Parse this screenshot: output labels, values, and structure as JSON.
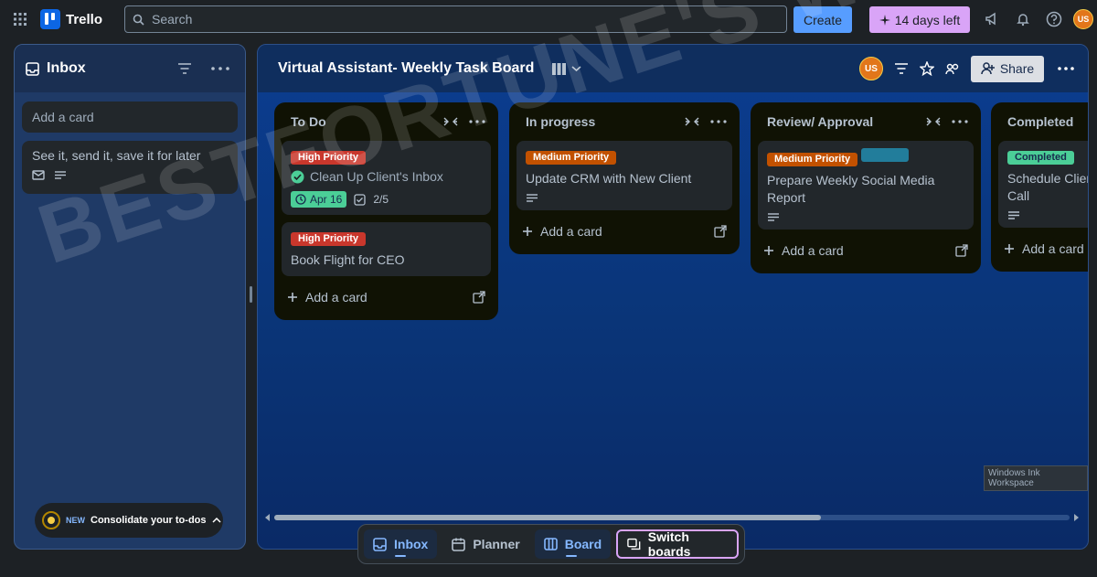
{
  "topbar": {
    "app_name": "Trello",
    "search_placeholder": "Search",
    "create_label": "Create",
    "trial_label": "14 days left",
    "avatar_initials": "US"
  },
  "inbox": {
    "title": "Inbox",
    "add_card_label": "Add a card",
    "cards": [
      {
        "title": "See it, send it, save it for later"
      }
    ],
    "promo": {
      "badge": "NEW",
      "text": "Consolidate your to-dos"
    }
  },
  "board": {
    "title": "Virtual Assistant- Weekly Task Board",
    "avatar_initials": "US",
    "share_label": "Share",
    "add_card_label": "Add a card",
    "lists": [
      {
        "name": "To Do",
        "cards": [
          {
            "labels": [
              "High Priority"
            ],
            "title": "Clean Up Client's Inbox",
            "complete": true,
            "due": "Apr 16",
            "checklist": "2/5"
          },
          {
            "labels": [
              "High Priority"
            ],
            "title": "Book Flight for CEO"
          }
        ]
      },
      {
        "name": "In progress",
        "cards": [
          {
            "labels": [
              "Medium Priority"
            ],
            "title": "Update CRM with New Client"
          }
        ]
      },
      {
        "name": "Review/ Approval",
        "cards": [
          {
            "labels": [
              "Medium Priority",
              ""
            ],
            "title": "Prepare Weekly Social Media Report"
          }
        ]
      },
      {
        "name": "Completed",
        "cards": [
          {
            "labels": [
              "Completed"
            ],
            "title": "Schedule Client Call"
          }
        ]
      }
    ]
  },
  "ink_workspace": "Windows Ink Workspace",
  "bottom_nav": {
    "inbox": "Inbox",
    "planner": "Planner",
    "board": "Board",
    "switch": "Switch boards"
  },
  "watermark": "BESTFORTUNE'S WORK",
  "colors": {
    "accent": "#579dff",
    "trial": "#d9a4f7",
    "high_priority": "#c9372c",
    "medium_priority": "#c25100",
    "completed": "#4bce97"
  }
}
